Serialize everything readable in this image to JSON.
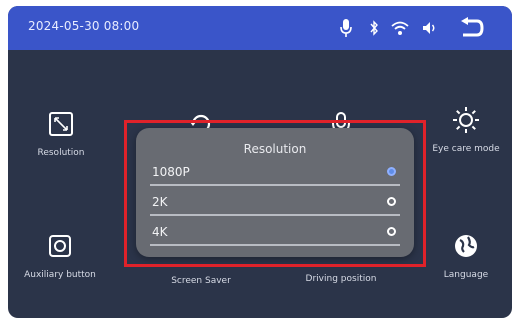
{
  "colors": {
    "statusbar_bg": "#3a55c9",
    "screen_bg": "#2b3449",
    "dialog_bg": "#686b72",
    "selected_radio": "#5f8de8",
    "highlight_border": "#e0222a"
  },
  "status": {
    "datetime": "2024-05-30 08:00",
    "icons": [
      "microphone-icon",
      "bluetooth-icon",
      "wifi-icon",
      "volume-icon",
      "back-icon"
    ]
  },
  "tiles": [
    {
      "label": "Resolution",
      "icon": "resolution-icon"
    },
    {
      "label": "",
      "icon": "rotate-icon"
    },
    {
      "label": "",
      "icon": "microphone-icon"
    },
    {
      "label": "Eye care mode",
      "icon": "brightness-icon"
    },
    {
      "label": "Auxiliary button",
      "icon": "auxiliary-button-icon"
    },
    {
      "label": "Screen Saver",
      "icon": "screen-saver-icon"
    },
    {
      "label": "Driving position",
      "icon": "driving-position-icon"
    },
    {
      "label": "Language",
      "icon": "globe-icon"
    }
  ],
  "resolution_dialog": {
    "title": "Resolution",
    "options": [
      {
        "label": "1080P",
        "selected": true
      },
      {
        "label": "2K",
        "selected": false
      },
      {
        "label": "4K",
        "selected": false
      }
    ]
  }
}
